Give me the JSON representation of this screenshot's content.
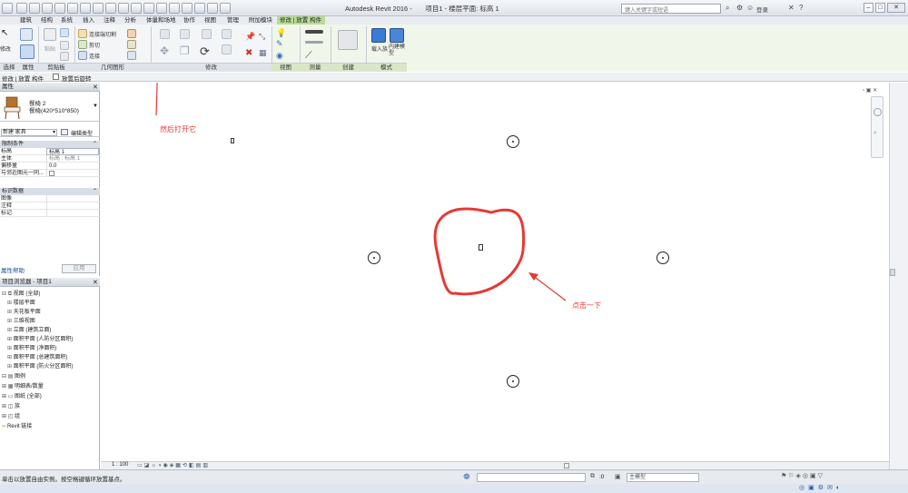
{
  "window": {
    "title": "Autodesk Revit 2016 -",
    "project_title": "项目1 - 楼层平面: 标高 1",
    "search_placeholder": "键入关键字或短语",
    "login_label": "登录"
  },
  "ribbon_tabs": [
    "建筑",
    "结构",
    "系统",
    "插入",
    "注释",
    "分析",
    "体量和场地",
    "协作",
    "视图",
    "管理",
    "附加模块",
    "修改 | 放置 构件"
  ],
  "ribbon": {
    "groups": [
      "选择",
      "属性",
      "剪贴板",
      "几何图形",
      "修改",
      "视图",
      "测量",
      "创建",
      "模式"
    ],
    "modify_label": "修改",
    "paste_label": "粘贴",
    "geometry_items": [
      "连接端切割",
      "剪切",
      "连接"
    ],
    "load_family_label": "载入族",
    "inplace_model_label": "内建模型"
  },
  "options_bar": {
    "context_label": "修改 | 放置 构件",
    "rotate_label": "放置后旋转"
  },
  "properties": {
    "header": "属性",
    "type_name": "餐椅 2",
    "type_size": "餐椅(420*510*850)",
    "category": "新建 家具",
    "edit_type_label": "编辑类型",
    "sections": [
      {
        "name": "限制条件",
        "rows": [
          {
            "k": "标高",
            "v": "标高 1"
          },
          {
            "k": "主体",
            "v": "标高 : 标高 1"
          },
          {
            "k": "偏移量",
            "v": "0.0"
          },
          {
            "k": "与邻近图元一同...",
            "v": ""
          }
        ]
      },
      {
        "name": "标识数据",
        "rows": [
          {
            "k": "图像",
            "v": ""
          },
          {
            "k": "注释",
            "v": ""
          },
          {
            "k": "标记",
            "v": ""
          }
        ]
      }
    ],
    "help_link": "属性帮助",
    "apply_label": "应用"
  },
  "browser": {
    "header": "项目浏览器 - 项目1",
    "items": [
      {
        "label": "视图 (全部)",
        "indent": 0
      },
      {
        "label": "楼层平面",
        "indent": 1
      },
      {
        "label": "天花板平面",
        "indent": 1
      },
      {
        "label": "三维视图",
        "indent": 1
      },
      {
        "label": "立面 (建筑立面)",
        "indent": 1
      },
      {
        "label": "面积平面 (人防分区面积)",
        "indent": 1
      },
      {
        "label": "面积平面 (净面积)",
        "indent": 1
      },
      {
        "label": "面积平面 (总建筑面积)",
        "indent": 1
      },
      {
        "label": "面积平面 (防火分区面积)",
        "indent": 1
      },
      {
        "label": "图例",
        "indent": 0
      },
      {
        "label": "明细表/数量",
        "indent": 0
      },
      {
        "label": "图纸 (全部)",
        "indent": 0
      },
      {
        "label": "族",
        "indent": 0
      },
      {
        "label": "组",
        "indent": 0
      },
      {
        "label": "Revit 链接",
        "indent": 0
      }
    ]
  },
  "view_control": {
    "scale": "1 : 100"
  },
  "status": {
    "message": "单击以放置自由实例。按空格键循环放置基点。",
    "model_label": "主模型",
    "zero_value": ":0"
  },
  "annotations": {
    "top_note": "然后打开它",
    "center_note": "点击一下"
  },
  "colors": {
    "annotation": "#e53935",
    "context_tab": "#b9dd8f"
  }
}
